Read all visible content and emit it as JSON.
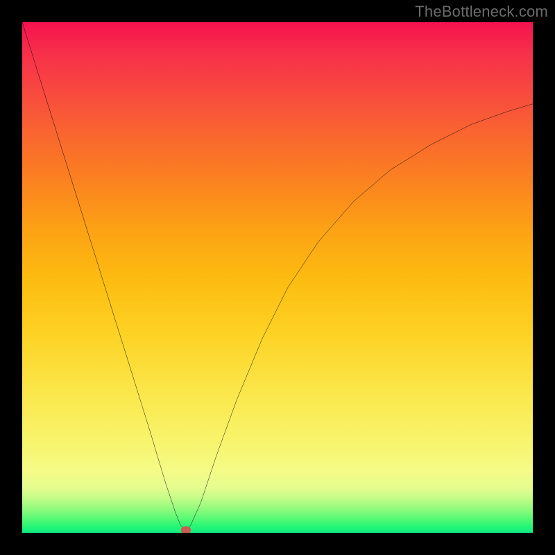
{
  "watermark": "TheBottleneck.com",
  "chart_data": {
    "type": "line",
    "title": "",
    "xlabel": "",
    "ylabel": "",
    "xlim": [
      0,
      100
    ],
    "ylim": [
      0,
      100
    ],
    "grid": false,
    "background": "vertical-gradient red→green",
    "series": [
      {
        "name": "bottleneck-curve",
        "x": [
          0,
          5,
          10,
          15,
          20,
          25,
          28,
          30,
          31,
          32,
          33,
          35,
          38,
          42,
          47,
          52,
          58,
          65,
          72,
          80,
          88,
          95,
          100
        ],
        "y": [
          100,
          84,
          68,
          52,
          36,
          20,
          10,
          4,
          1.5,
          0.5,
          1.5,
          6,
          15,
          26,
          38,
          48,
          57,
          65,
          71,
          76,
          80,
          82.5,
          84
        ]
      }
    ],
    "minimum_point": {
      "x": 32,
      "y": 0.5
    },
    "colors": {
      "curve": "#000000",
      "frame": "#000000",
      "min_dot": "#cf5a56",
      "gradient_top": "#f6124f",
      "gradient_bottom": "#13e77e"
    }
  }
}
